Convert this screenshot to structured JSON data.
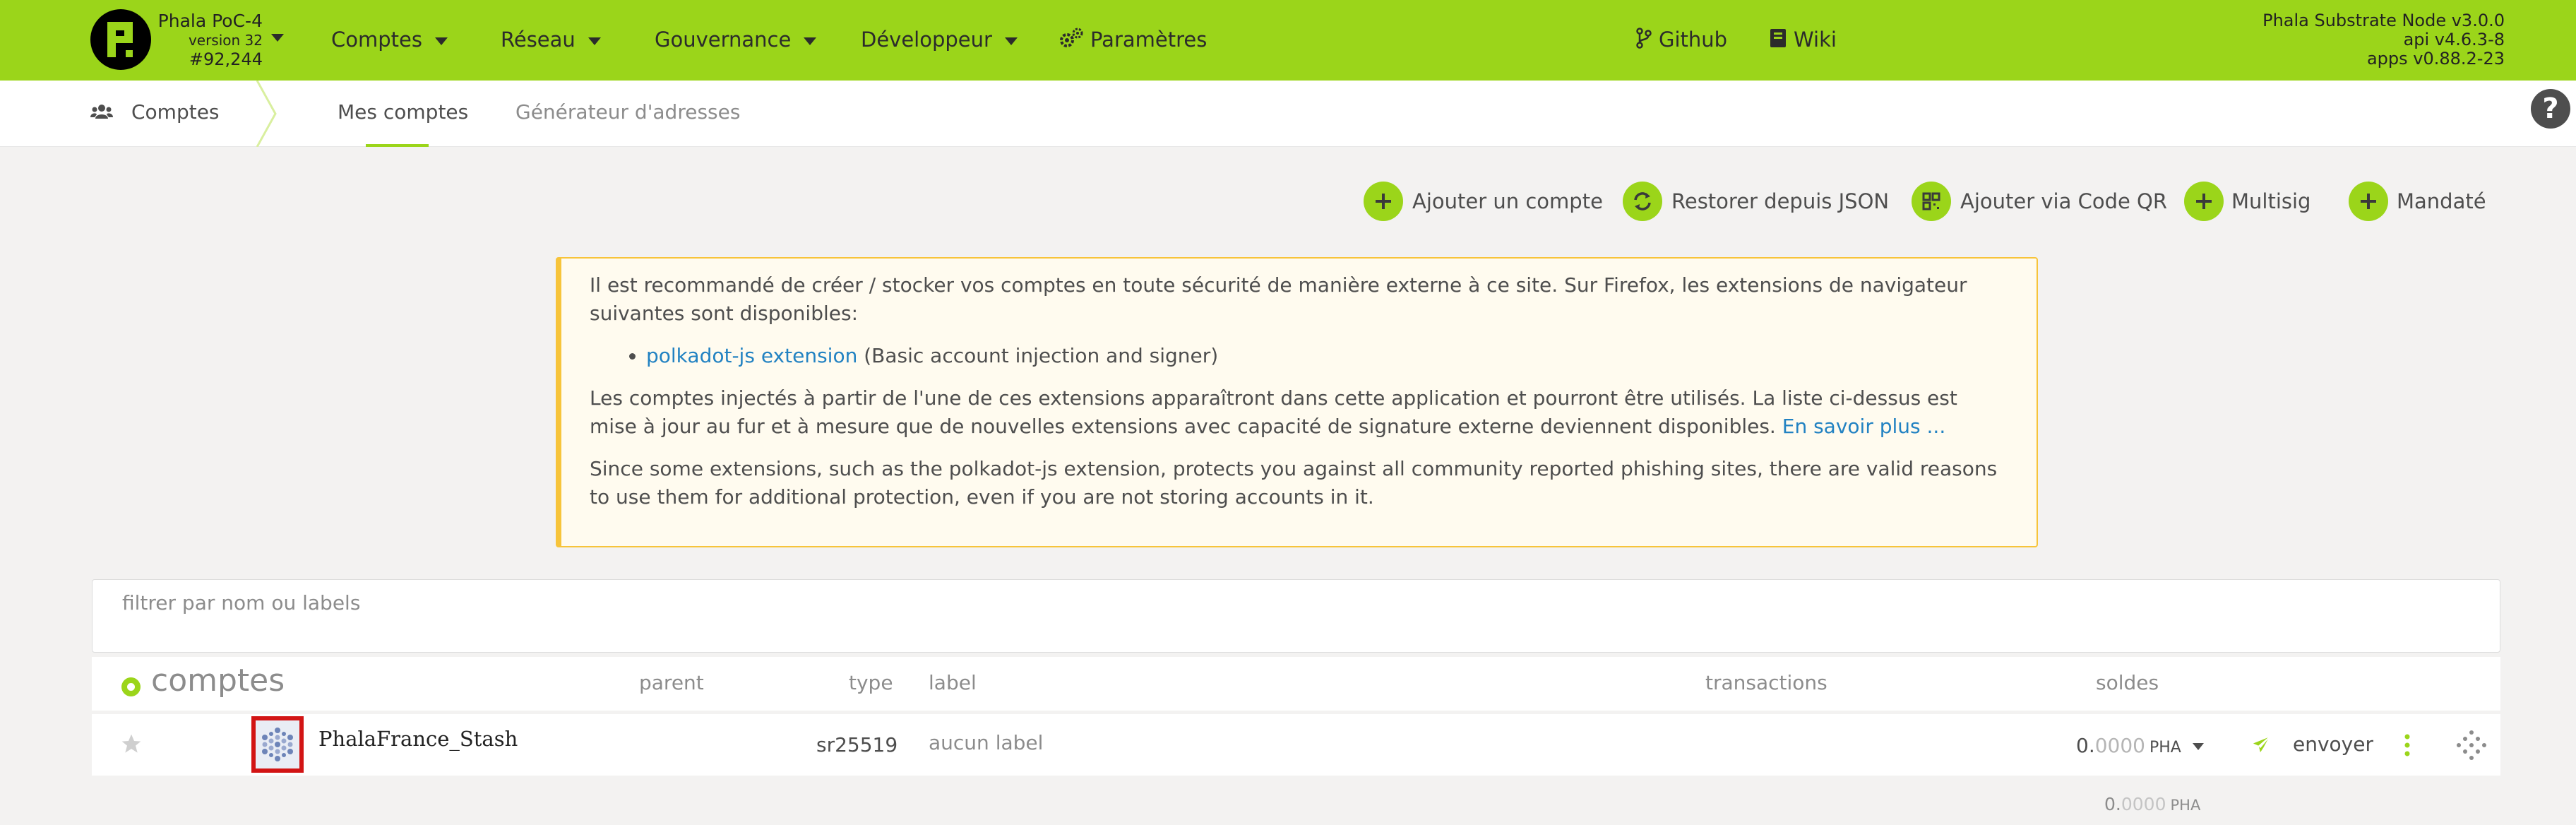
{
  "chain": {
    "name": "Phala PoC-4",
    "version": "version 32",
    "block": "#92,244"
  },
  "nav": {
    "items": [
      {
        "label": "Comptes"
      },
      {
        "label": "Réseau"
      },
      {
        "label": "Gouvernance"
      },
      {
        "label": "Développeur"
      }
    ],
    "settings_label": "Paramètres",
    "github_label": "Github",
    "wiki_label": "Wiki"
  },
  "node": {
    "name": "Phala Substrate Node v3.0.0",
    "api": "api v4.6.3-8",
    "apps": "apps v0.88.2-23"
  },
  "tabs": {
    "section": "Comptes",
    "items": [
      {
        "label": "Mes comptes"
      },
      {
        "label": "Générateur d'adresses"
      }
    ]
  },
  "help_label": "?",
  "actions": {
    "add_account": "Ajouter un compte",
    "restore_json": "Restorer depuis JSON",
    "add_qr": "Ajouter via Code QR",
    "multisig": "Multisig",
    "proxied": "Mandaté"
  },
  "notice": {
    "p1": "Il est recommandé de créer / stocker vos comptes en toute sécurité de manière externe à ce site. Sur Firefox, les extensions de navigateur suivantes sont disponibles:",
    "ext_link": "polkadot-js extension",
    "ext_desc": " (Basic account injection and signer)",
    "p2": "Les comptes injectés à partir de l'une de ces extensions apparaîtront dans cette application et pourront être utilisés. La liste ci-dessus est mise à jour au fur et à mesure que de nouvelles extensions avec capacité de signature externe deviennent disponibles. ",
    "learn_more": "En savoir plus ...",
    "p3": "Since some extensions, such as the polkadot-js extension, protects you against all community reported phishing sites, there are valid reasons to use them for additional protection, even if you are not storing accounts in it."
  },
  "filter": {
    "placeholder": "filtrer par nom ou labels",
    "value": ""
  },
  "table": {
    "title": "comptes",
    "headers": {
      "parent": "parent",
      "type": "type",
      "label": "label",
      "transactions": "transactions",
      "balances": "soldes"
    },
    "rows": [
      {
        "name": "PhalaFrance_Stash",
        "type": "sr25519",
        "label": "aucun label",
        "balance_int": "0.",
        "balance_dec": "0000",
        "balance_unit": "PHA",
        "send_label": "envoyer"
      }
    ],
    "total": {
      "int": "0.",
      "dec": "0000",
      "unit": "PHA"
    }
  },
  "colors": {
    "accent": "#9bd51a",
    "notice_border": "#f7c43a",
    "link": "#2282c2",
    "highlight_box": "#d21414"
  }
}
